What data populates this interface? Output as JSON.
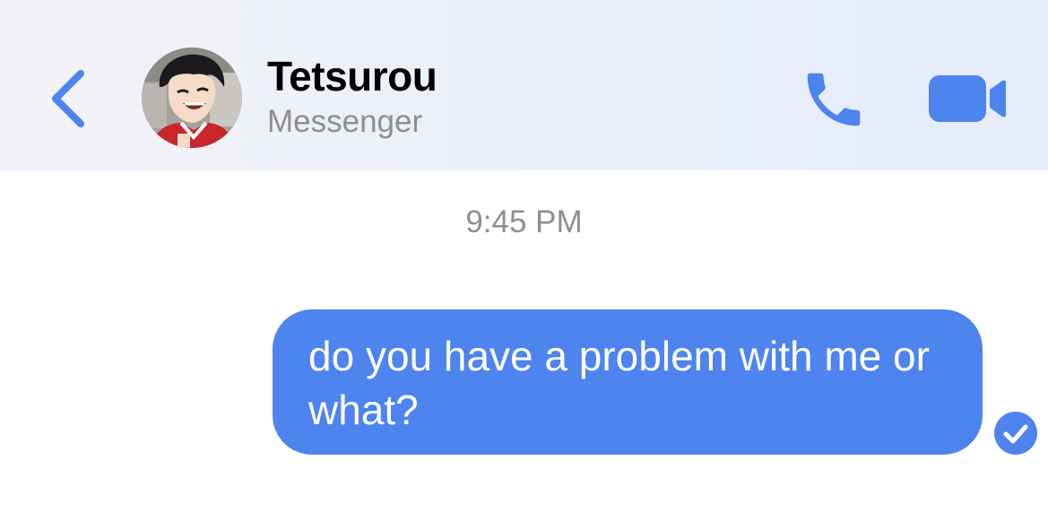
{
  "header": {
    "contact_name": "Tetsurou",
    "contact_subtitle": "Messenger"
  },
  "conversation": {
    "timestamp": "9:45 PM",
    "messages": [
      {
        "sender": "me",
        "text": "do you have a problem with me or what?",
        "status_icon": "sent-check-icon"
      }
    ]
  },
  "icons": {
    "back": "chevron-left-icon",
    "call": "phone-icon",
    "video": "video-camera-icon"
  },
  "colors": {
    "accent": "#4d84ee",
    "bubble": "#4d84ee",
    "secondary_text": "#8e8e93",
    "header_bg": "#eceff7"
  }
}
